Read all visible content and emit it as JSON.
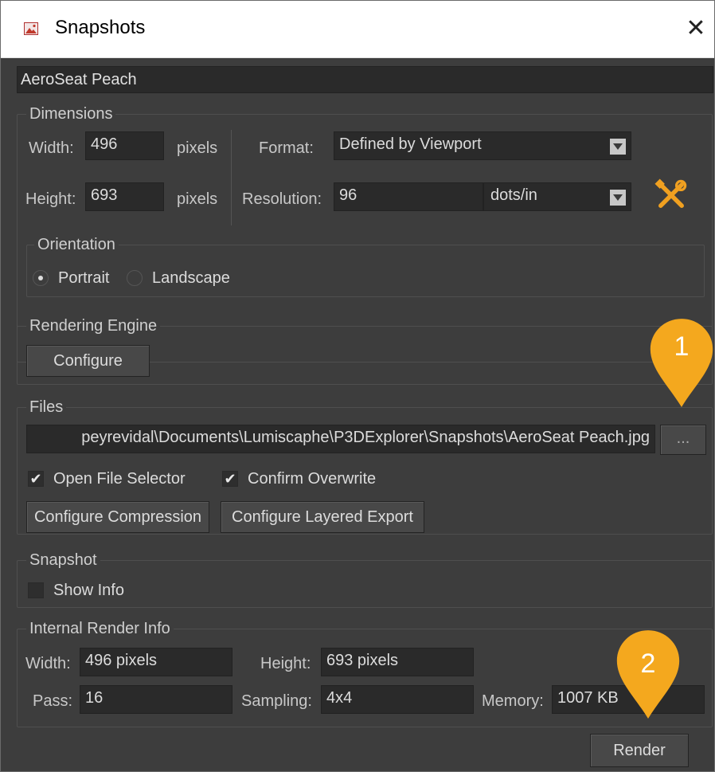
{
  "window": {
    "title": "Snapshots",
    "close_glyph": "✕"
  },
  "name_field": {
    "value": "AeroSeat Peach"
  },
  "dimensions": {
    "title": "Dimensions",
    "width_label": "Width:",
    "width_value": "496",
    "width_unit": "pixels",
    "height_label": "Height:",
    "height_value": "693",
    "height_unit": "pixels",
    "format_label": "Format:",
    "format_value": "Defined by Viewport",
    "resolution_label": "Resolution:",
    "resolution_value": "96",
    "resolution_unit": "dots/in",
    "tools_icon": "wrench-screwdriver-icon"
  },
  "orientation": {
    "title": "Orientation",
    "options": [
      "Portrait",
      "Landscape"
    ],
    "selected": "Portrait"
  },
  "rendering_engine": {
    "title": "Rendering Engine",
    "configure_label": "Configure"
  },
  "files": {
    "title": "Files",
    "path_value": "peyrevidal\\Documents\\Lumiscaphe\\P3DExplorer\\Snapshots\\AeroSeat Peach.jpg",
    "browse_label": "...",
    "open_file_selector_label": "Open File Selector",
    "open_file_selector_checked": true,
    "confirm_overwrite_label": "Confirm Overwrite",
    "confirm_overwrite_checked": true,
    "configure_compression_label": "Configure Compression",
    "configure_layered_export_label": "Configure Layered Export"
  },
  "snapshot": {
    "title": "Snapshot",
    "show_info_label": "Show Info",
    "show_info_checked": false
  },
  "internal_render_info": {
    "title": "Internal Render Info",
    "width_label": "Width:",
    "width_value": "496 pixels",
    "height_label": "Height:",
    "height_value": "693 pixels",
    "pass_label": "Pass:",
    "pass_value": "16",
    "sampling_label": "Sampling:",
    "sampling_value": "4x4",
    "memory_label": "Memory:",
    "memory_value": "1007 KB"
  },
  "render_button": {
    "label": "Render"
  },
  "callouts": [
    {
      "number": "1",
      "color": "#f4a81e"
    },
    {
      "number": "2",
      "color": "#f4a81e"
    }
  ]
}
